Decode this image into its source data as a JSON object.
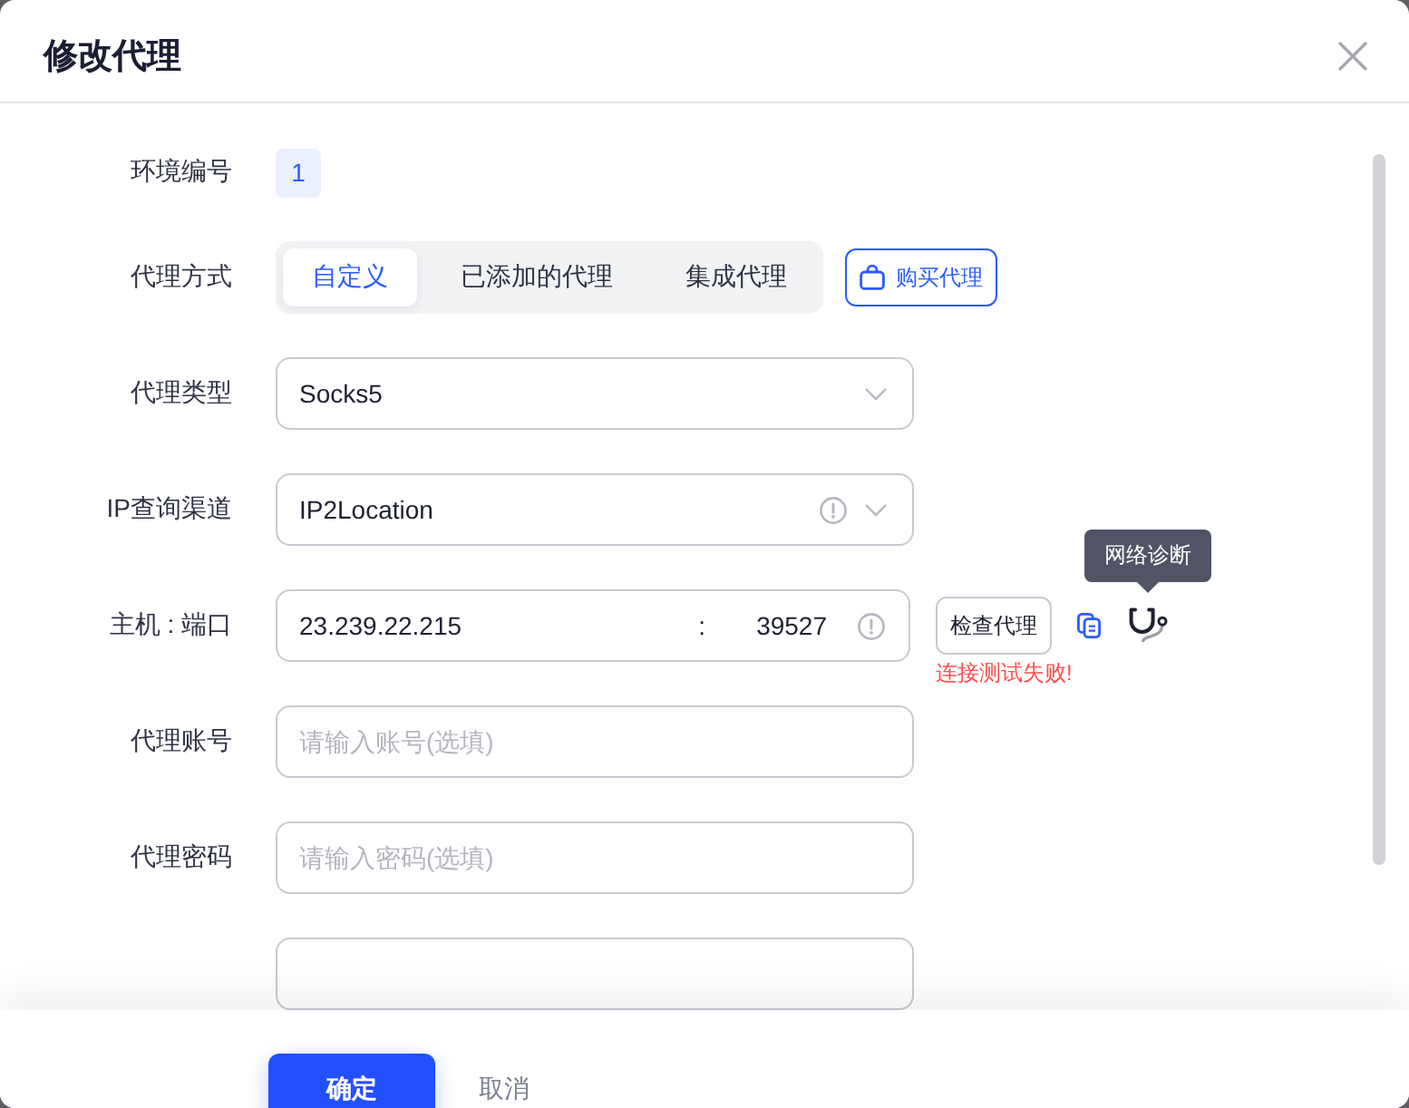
{
  "dialog": {
    "title": "修改代理"
  },
  "form": {
    "fields": [
      {
        "kind": "badge",
        "label": "环境编号",
        "value": "1"
      },
      {
        "kind": "segmented",
        "label": "代理方式",
        "options": [
          {
            "label": "自定义",
            "selected": true
          },
          {
            "label": "已添加的代理",
            "selected": false
          },
          {
            "label": "集成代理",
            "selected": false
          }
        ],
        "action": {
          "label": "购买代理"
        }
      },
      {
        "kind": "select",
        "label": "代理类型",
        "value": "Socks5"
      },
      {
        "kind": "select",
        "label": "IP查询渠道",
        "value": "IP2Location",
        "info": true
      },
      {
        "kind": "host_port",
        "label": "主机 : 端口",
        "host": "23.239.22.215",
        "separator": ":",
        "port": "39527",
        "info": true,
        "check_button": "检查代理",
        "tooltip": "网络诊断",
        "error": "连接测试失败!"
      },
      {
        "kind": "input",
        "label": "代理账号",
        "placeholder": "请输入账号(选填)"
      },
      {
        "kind": "input",
        "label": "代理密码",
        "placeholder": "请输入密码(选填)"
      },
      {
        "kind": "input"
      }
    ]
  },
  "footer": {
    "buttons": [
      {
        "kind": "primary",
        "label": "确定"
      },
      {
        "kind": "text",
        "label": "取消"
      }
    ]
  }
}
